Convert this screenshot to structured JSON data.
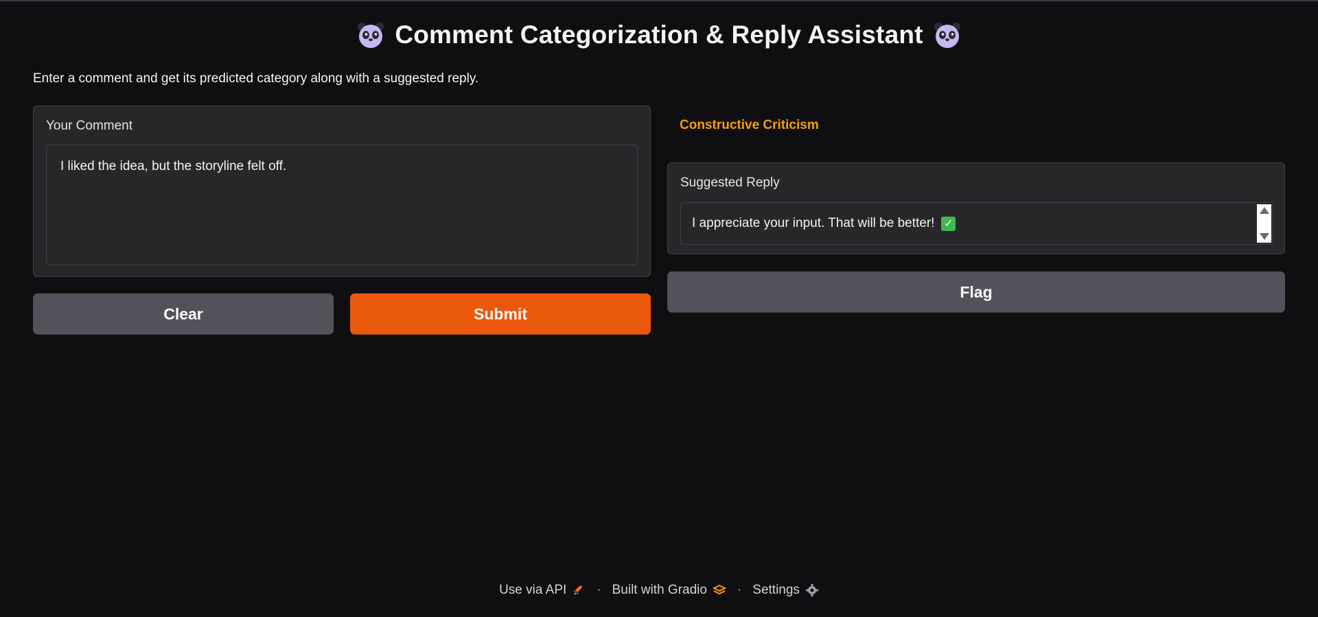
{
  "header": {
    "title": "Comment Categorization & Reply Assistant",
    "description": "Enter a comment and get its predicted category along with a suggested reply."
  },
  "input": {
    "label": "Your Comment",
    "value": "I liked the idea, but the storyline felt off."
  },
  "buttons": {
    "clear": "Clear",
    "submit": "Submit",
    "flag": "Flag"
  },
  "output": {
    "category": "Constructive Criticism",
    "reply_label": "Suggested Reply",
    "reply_value": "I appreciate your input. That will be better!",
    "reply_emoji_icon": "check-mark-icon"
  },
  "footer": {
    "api_link": "Use via API",
    "built_with": "Built with Gradio",
    "settings": "Settings",
    "separator": "·"
  },
  "colors": {
    "background": "#0f0f11",
    "panel": "#27272a",
    "accent_orange": "#ea580c",
    "category_color": "#f59e0b",
    "secondary_button": "#52525b"
  }
}
